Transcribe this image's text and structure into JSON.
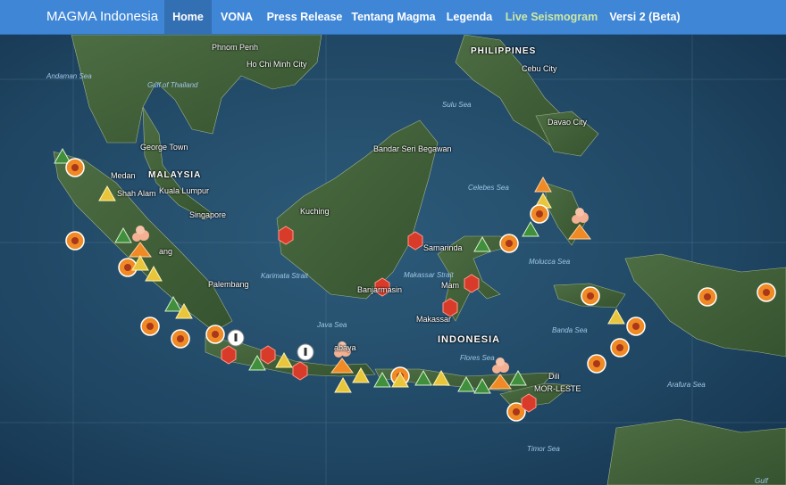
{
  "nav": {
    "brand": "MAGMA Indonesia",
    "items": [
      {
        "label": "Home"
      },
      {
        "label": "VONA"
      },
      {
        "label": "Press Release"
      },
      {
        "label": "Tentang Magma"
      },
      {
        "label": "Legenda"
      },
      {
        "label": "Live Seismogram"
      },
      {
        "label": "Versi 2 (Beta)"
      }
    ]
  },
  "map_labels": {
    "phnom_penh": "Phnom Penh",
    "ho_chi_minh": "Ho Chi Minh City",
    "andaman_sea": "Andaman Sea",
    "gulf_of_thailand": "Gulf of Thailand",
    "philippines": "PHILIPPINES",
    "cebu": "Cebu City",
    "sulu_sea": "Sulu Sea",
    "davao": "Davao City",
    "bandar": "Bandar Seri Begawan",
    "george_town": "George Town",
    "malaysia": "MALAYSIA",
    "medan": "Medan",
    "shah_alam": "Shah Alam",
    "kuala_lumpur": "Kuala Lumpur",
    "singapore": "Singapore",
    "celebes_sea": "Celebes Sea",
    "kuching": "Kuching",
    "samarinda": "Samarinda",
    "padang": "ang",
    "palembang": "Palembang",
    "karimata": "Karimata Strait",
    "makassar_strait": "Makassar Strait",
    "banjarmasin": "Banjarmasin",
    "mamuju": "Mam",
    "molucca_sea": "Molucca Sea",
    "java_sea": "Java Sea",
    "makassar": "Makassar",
    "indonesia": "INDONESIA",
    "banda_sea": "Banda Sea",
    "surabaya": "abaya",
    "flores_sea": "Flores Sea",
    "dili": "Dili",
    "timor_leste": "MOR-LESTE",
    "arafura_sea": "Arafura Sea",
    "timor_sea": "Timor Sea",
    "gulf_right": "Gulf"
  },
  "legend_colors": {
    "normal": "#3f8f3c",
    "waspada": "#e9c53b",
    "siaga": "#f08a24",
    "awas": "#d83b2a",
    "ocean": "#1d3f5a",
    "land": "#41603a",
    "navbar": "#3f86d6"
  },
  "marker_types": [
    "volcano-triangle",
    "volcano-eruption-icon",
    "earthquake-circle-icon",
    "ground-movement-hexagon",
    "info-pin-icon"
  ]
}
